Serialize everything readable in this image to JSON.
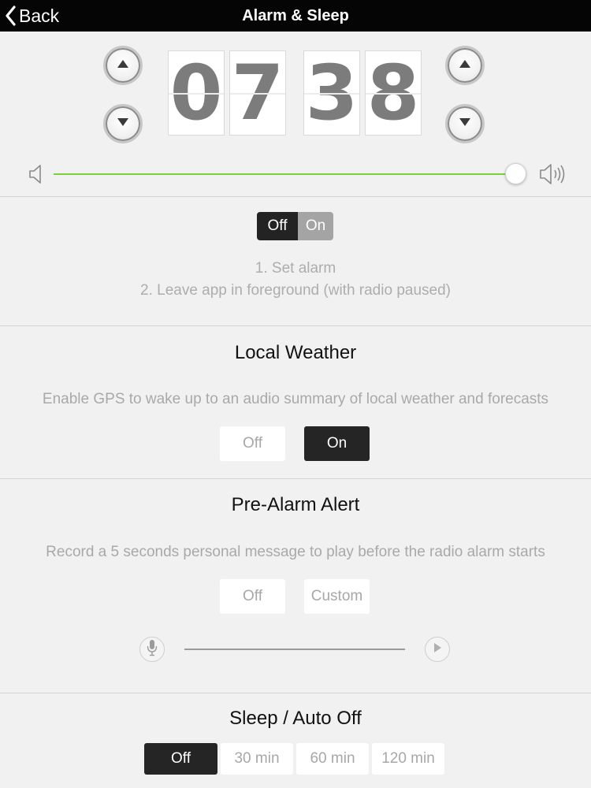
{
  "nav": {
    "back_label": "Back",
    "title": "Alarm & Sleep"
  },
  "time": {
    "hour_tens": "0",
    "hour_ones": "7",
    "minute_tens": "3",
    "minute_ones": "8"
  },
  "volume": {
    "level": 0.97,
    "accent_color": "#7ccf3c"
  },
  "alarm": {
    "toggle_off": "Off",
    "toggle_on": "On",
    "selected": "Off",
    "hint_line1": "1. Set alarm",
    "hint_line2": "2. Leave app in foreground (with radio paused)"
  },
  "weather": {
    "title": "Local Weather",
    "description": "Enable GPS to wake up to an audio summary of local weather and forecasts",
    "off_label": "Off",
    "on_label": "On",
    "selected": "On"
  },
  "prealarm": {
    "title": "Pre-Alarm Alert",
    "description": "Record a 5 seconds personal message to play before the radio alarm starts",
    "off_label": "Off",
    "custom_label": "Custom"
  },
  "sleep": {
    "title": "Sleep / Auto Off",
    "options": [
      "Off",
      "30 min",
      "60 min",
      "120 min"
    ],
    "selected": "Off"
  },
  "icons": {
    "back": "chevron-left-icon",
    "up": "triangle-up-icon",
    "down": "triangle-down-icon",
    "volume_low": "speaker-icon",
    "volume_high": "speaker-loud-icon",
    "mic": "microphone-icon",
    "play": "play-icon"
  }
}
